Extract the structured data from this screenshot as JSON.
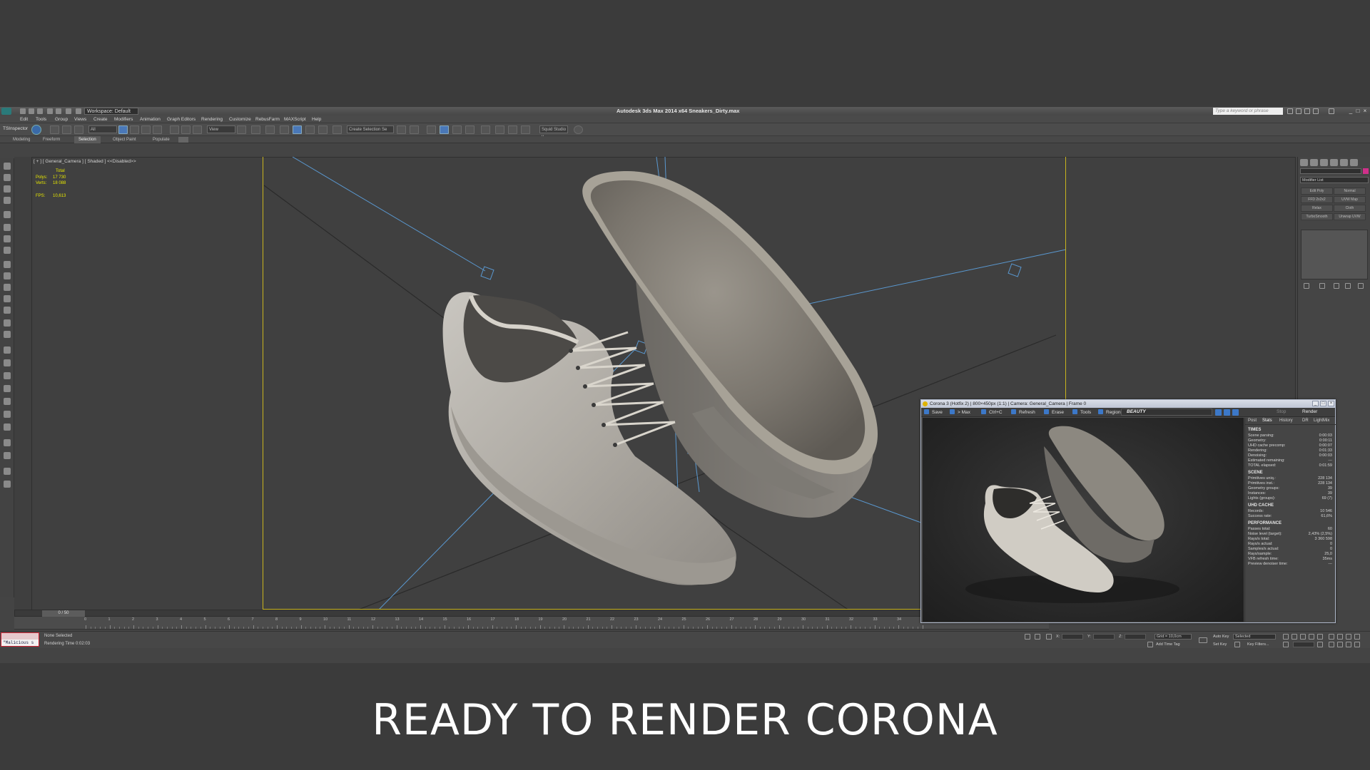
{
  "caption": "READY TO RENDER CORONA",
  "app": {
    "title": "Autodesk 3ds Max  2014 x64    Sneakers_Dirty.max",
    "workspace": "Workspace: Default",
    "search_placeholder": "Type a keyword or phrase",
    "menu": [
      "Edit",
      "Tools",
      "Group",
      "Views",
      "Create",
      "Modifiers",
      "Animation",
      "Graph Editors",
      "Rendering",
      "Customize",
      "RebusFarm",
      "MAXScript",
      "Help"
    ],
    "toolbar": {
      "tsinspector": "TSInspector",
      "filter": "All",
      "ref_coord": "View",
      "named_selection": "Create Selection Se",
      "squid": "Squid Studio v"
    },
    "ribbon_tabs": [
      "Modeling",
      "Freeform",
      "Selection",
      "Object Paint",
      "Populate"
    ],
    "ribbon_active": "Selection"
  },
  "viewport": {
    "label": "[ + ] [ General_Camera ] [ Shaded ]  <<Disabled>>",
    "stats": {
      "total_label": "Total",
      "polys_label": "Polys:",
      "polys": "17 730",
      "verts_label": "Verts:",
      "verts": "18 088",
      "fps_label": "FPS:",
      "fps": "10,613"
    }
  },
  "timeline": {
    "slider": "0 / 50",
    "ticks": [
      "0",
      "1",
      "2",
      "3",
      "4",
      "5",
      "6",
      "7",
      "8",
      "9",
      "10",
      "11",
      "12",
      "13",
      "14",
      "15",
      "16",
      "17",
      "18",
      "19",
      "20",
      "21",
      "22",
      "23",
      "24",
      "25",
      "26",
      "27",
      "28",
      "29",
      "30",
      "31",
      "32",
      "33",
      "34",
      "35"
    ]
  },
  "statusbar": {
    "maxscript": "\"Malicious s",
    "selection": "None Selected",
    "render_time": "Rendering Time  0:02:03",
    "x_label": "X:",
    "y_label": "Y:",
    "z_label": "Z:",
    "grid": "Grid = 10,0cm",
    "add_time_tag": "Add Time Tag",
    "auto_key": "Auto Key",
    "auto_key_value": "Selected",
    "set_key": "Set Key",
    "key_filters": "Key Filters..."
  },
  "cmdpanel": {
    "modifier_list": "Modifier List",
    "modifiers": [
      "Edit Poly",
      "Normal",
      "FFD 2x2x2",
      "UVW Map",
      "Relax",
      "Cloth",
      "TurboSmooth",
      "Unwrap UVW"
    ]
  },
  "vfb": {
    "title": "Corona 3 (Hotfix 2) | 800×450px (1:1) | Camera: General_Camera | Frame 0",
    "toolbar": {
      "save": "Save",
      "to_max": "> Max",
      "copy": "Ctrl+C",
      "refresh": "Refresh",
      "erase": "Erase",
      "tools": "Tools",
      "region": "Region",
      "channel": "BEAUTY",
      "stop": "Stop",
      "render": "Render"
    },
    "tabs": [
      "Post",
      "Stats",
      "History",
      "DR",
      "LightMix"
    ],
    "active_tab": "Stats",
    "sections": [
      {
        "title": "TIMES",
        "rows": [
          [
            "Scene parsing:",
            "0:00:03"
          ],
          [
            "Geometry:",
            "0:00:11"
          ],
          [
            "UHD cache precomp:",
            "0:00:07"
          ],
          [
            "Rendering:",
            "0:01:33"
          ],
          [
            "Denoising:",
            "0:00:03"
          ],
          [
            "Estimated remaining:",
            "---"
          ],
          [
            "TOTAL elapsed:",
            "0:01:59"
          ]
        ]
      },
      {
        "title": "SCENE",
        "rows": [
          [
            "Primitives uniq.:",
            "228 134"
          ],
          [
            "Primitives inst.:",
            "228 134"
          ],
          [
            "Geometry groups:",
            "39"
          ],
          [
            "Instances:",
            "39"
          ],
          [
            "Lights (groups):",
            "69 (7)"
          ]
        ]
      },
      {
        "title": "UHD CACHE",
        "rows": [
          [
            "Records:",
            "10 546"
          ],
          [
            "Success rate:",
            "61,6%"
          ]
        ]
      },
      {
        "title": "PERFORMANCE",
        "rows": [
          [
            "Passes total:",
            "60"
          ],
          [
            "Noise level (target):",
            "2,43% (2,5%)"
          ],
          [
            "Rays/s total:",
            "3 360 598"
          ],
          [
            "Rays/s actual:",
            "0"
          ],
          [
            "Samples/s actual:",
            "0"
          ],
          [
            "Rays/sample:",
            "25,0"
          ],
          [
            "VFB refresh time:",
            "35ms"
          ],
          [
            "Preview denoiser time:",
            "---"
          ]
        ]
      }
    ]
  },
  "colors": {
    "background": "#3b3b3b",
    "safe_frame": "#c9b41e",
    "stats_text": "#e6e600",
    "camera_lines": "#5a98d0",
    "accent": "#3c78c8"
  }
}
